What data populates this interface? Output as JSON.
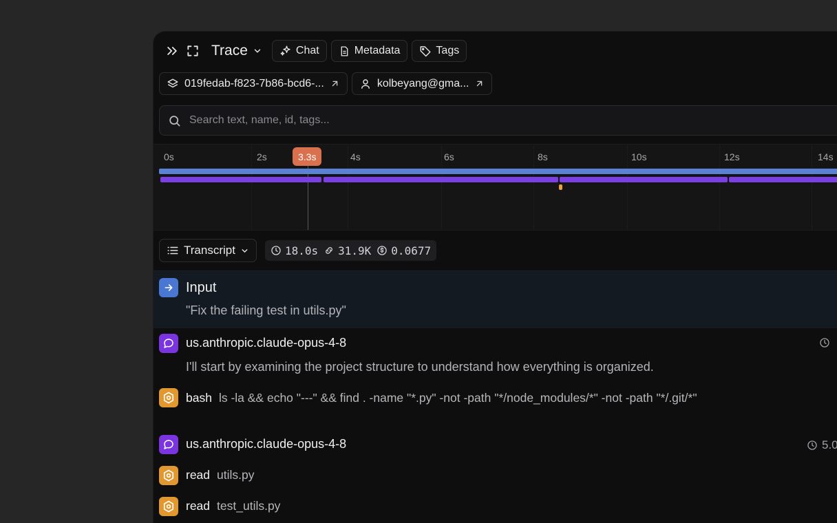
{
  "header": {
    "title": "Trace",
    "tabs": [
      {
        "label": "Chat",
        "icon": "sparkles-icon"
      },
      {
        "label": "Metadata",
        "icon": "document-icon"
      },
      {
        "label": "Tags",
        "icon": "tag-icon"
      }
    ]
  },
  "chips": {
    "trace_id": "019fedab-f823-7b86-bcd6-...",
    "user": "kolbeyang@gma..."
  },
  "search": {
    "placeholder": "Search text, name, id, tags..."
  },
  "timeline": {
    "ticks": [
      "0s",
      "2s",
      "4s",
      "6s",
      "8s",
      "10s",
      "12s",
      "14s"
    ],
    "cursor": "3.3s",
    "colors": {
      "root": "#5a83d6",
      "llm": "#7b3fe4",
      "tool": "#e6a23c",
      "cursor": "#d9714f"
    }
  },
  "stats": {
    "view": "Transcript",
    "duration": "18.0s",
    "tokens": "31.9K",
    "cost": "0.0677"
  },
  "transcript": {
    "input": {
      "label": "Input",
      "text": "\"Fix the failing test in utils.py\""
    },
    "messages": [
      {
        "model": "us.anthropic.claude-opus-4-8",
        "time": "",
        "text": "I'll start by examining the project structure to understand how everything is organized.",
        "tools": [
          {
            "name": "bash",
            "arg": "ls -la && echo \"---\" && find . -name \"*.py\" -not -path \"*/node_modules/*\" -not -path \"*/.git/*\""
          }
        ]
      },
      {
        "model": "us.anthropic.claude-opus-4-8",
        "time": "5.0",
        "tools": [
          {
            "name": "read",
            "arg": "utils.py"
          },
          {
            "name": "read",
            "arg": "test_utils.py"
          }
        ]
      }
    ]
  }
}
